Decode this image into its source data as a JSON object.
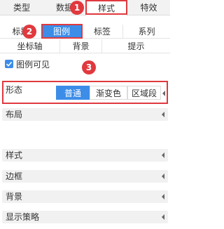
{
  "top_tabs": [
    {
      "label": "类型",
      "active": false
    },
    {
      "label": "数据",
      "active": false
    },
    {
      "label": "样式",
      "active": true
    },
    {
      "label": "特效",
      "active": false
    }
  ],
  "sub_tabs_row1": [
    {
      "label": "标题",
      "active": false
    },
    {
      "label": "图例",
      "active": true
    },
    {
      "label": "标签",
      "active": false
    },
    {
      "label": "系列",
      "active": false
    }
  ],
  "sub_tabs_row2": [
    {
      "label": "坐标轴"
    },
    {
      "label": "背景"
    },
    {
      "label": "提示"
    }
  ],
  "badges": [
    "1",
    "2",
    "3"
  ],
  "legend_visible": {
    "label": "图例可见",
    "checked": true
  },
  "form": {
    "label": "形态",
    "options": [
      "普通",
      "渐变色",
      "区域段"
    ],
    "selected": "普通"
  },
  "sections": [
    {
      "label": "布局"
    },
    {
      "label": "样式"
    },
    {
      "label": "边框"
    },
    {
      "label": "背景"
    },
    {
      "label": "显示策略"
    }
  ],
  "colors": {
    "accent": "#3c8de8",
    "highlight_red": "#e0393e",
    "section_bg": "#f1f1f1"
  }
}
